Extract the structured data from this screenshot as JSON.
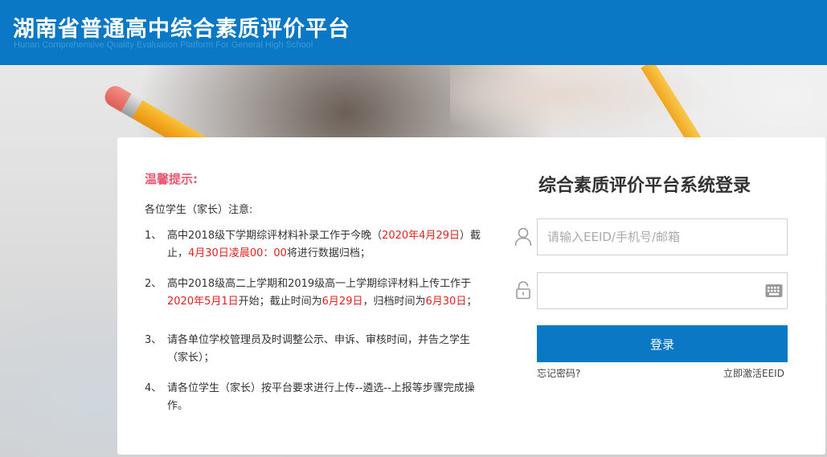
{
  "header": {
    "title": "湖南省普通高中综合素质评价平台",
    "subtitle": "Hunan Comprehensive Quality Evaluation Platform For General High School"
  },
  "notice": {
    "title": "温馨提示:",
    "greeting": "各位学生（家长）注意:",
    "items": [
      {
        "num": "1、",
        "parts": [
          {
            "text": "高中2018级下学期综评材料补录工作于今晚（"
          },
          {
            "text": "2020年4月29日",
            "red": true
          },
          {
            "text": "）截止，"
          },
          {
            "text": "4月30日凌晨00：00",
            "red": true
          },
          {
            "text": "将进行数据归档；"
          }
        ]
      },
      {
        "num": "2、",
        "parts": [
          {
            "text": "高中2018级高二上学期和2019级高一上学期综评材料上传工作于"
          },
          {
            "text": "2020年5月1日",
            "red": true
          },
          {
            "text": "开始；截止时间为"
          },
          {
            "text": "6月29日",
            "red": true
          },
          {
            "text": "，归档时间为"
          },
          {
            "text": "6月30日",
            "red": true
          },
          {
            "text": "；"
          }
        ]
      },
      {
        "num": "3、",
        "parts": [
          {
            "text": "请各单位学校管理员及时调整公示、申诉、审核时间，并告之学生（家长）；"
          }
        ]
      },
      {
        "num": "4、",
        "parts": [
          {
            "text": "请各位学生（家长）按平台要求进行上传--遴选--上报等步骤完成操作。"
          }
        ]
      }
    ]
  },
  "login": {
    "title": "综合素质评价平台系统登录",
    "account_placeholder": "请输入EEID/手机号/邮箱",
    "account_value": "",
    "password_value": "",
    "login_label": "登录",
    "forgot_label": "忘记密码?",
    "activate_label": "立即激活EEID"
  },
  "icons": {
    "account": "user-icon",
    "password": "lock-icon",
    "keyboard": "keyboard-icon"
  },
  "colors": {
    "brand": "#0a78c4",
    "notice_title": "#e8566f",
    "highlight": "#e3221f"
  }
}
